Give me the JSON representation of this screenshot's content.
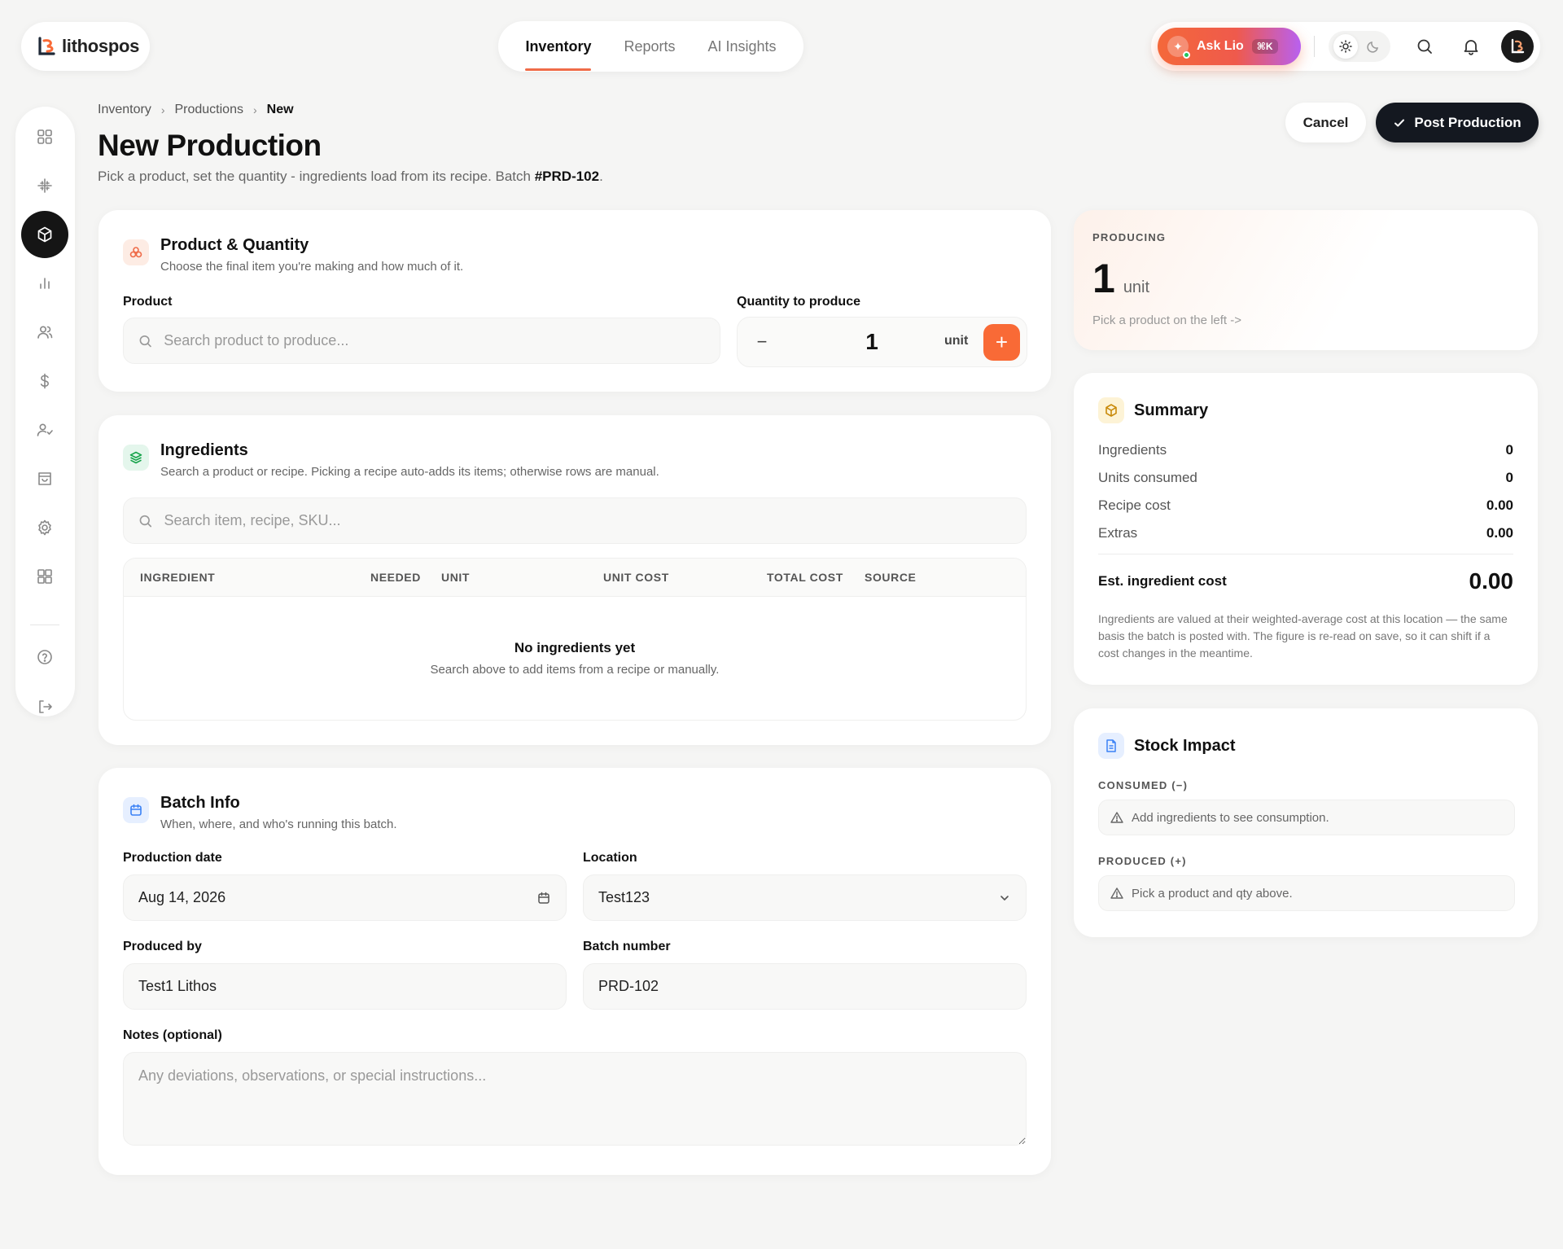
{
  "app": {
    "name": "lithospos",
    "colors": {
      "accent": "#f96a36",
      "dark": "#141820",
      "background": "#f5f5f4"
    }
  },
  "topnav": {
    "tabs": [
      {
        "label": "Inventory",
        "active": true
      },
      {
        "label": "Reports",
        "active": false
      },
      {
        "label": "AI Insights",
        "active": false
      }
    ]
  },
  "topbar": {
    "ask_label": "Ask Lio",
    "ask_shortcut": "⌘K",
    "icons": [
      "sun-icon",
      "moon-icon",
      "search-icon",
      "bell-icon",
      "avatar"
    ]
  },
  "sidebar": {
    "items": [
      {
        "icon": "grid-icon"
      },
      {
        "icon": "snowflake-icon"
      },
      {
        "icon": "box-icon",
        "active": true
      },
      {
        "icon": "bar-chart-icon"
      },
      {
        "icon": "users-icon"
      },
      {
        "icon": "dollar-icon"
      },
      {
        "icon": "user-check-icon"
      },
      {
        "icon": "shopping-bag-icon"
      },
      {
        "icon": "settings-icon"
      },
      {
        "icon": "layout-icon"
      },
      {
        "icon": "help-icon"
      },
      {
        "icon": "logout-icon"
      }
    ]
  },
  "breadcrumb": [
    "Inventory",
    "Productions",
    "New"
  ],
  "header": {
    "title": "New Production",
    "subtitle": "Pick a product, set the quantity - ingredients load from its recipe. Batch ",
    "batch_ref": "#PRD-102",
    "subtitle_end": ".",
    "cancel_label": "Cancel",
    "post_label": "Post Production"
  },
  "product_card": {
    "title": "Product & Quantity",
    "description": "Choose the final item you're making and how much of it.",
    "product_label": "Product",
    "product_placeholder": "Search product to produce...",
    "quantity_label": "Quantity to produce",
    "quantity_value": "1",
    "quantity_unit": "unit",
    "minus": "−",
    "plus": "+"
  },
  "ingredients_card": {
    "title": "Ingredients",
    "description": "Search a product or recipe. Picking a recipe auto-adds its items; otherwise rows are manual.",
    "search_placeholder": "Search item, recipe, SKU...",
    "columns": [
      "INGREDIENT",
      "NEEDED",
      "UNIT",
      "UNIT COST",
      "TOTAL COST",
      "SOURCE"
    ],
    "empty_title": "No ingredients yet",
    "empty_description": "Search above to add items from a recipe or manually."
  },
  "batch_card": {
    "title": "Batch Info",
    "description": "When, where, and who's running this batch.",
    "date_label": "Production date",
    "date_value": "Aug 14, 2026",
    "location_label": "Location",
    "location_value": "Test123",
    "produced_by_label": "Produced by",
    "produced_by_value": "Test1 Lithos",
    "batch_number_label": "Batch number",
    "batch_number_value": "PRD-102",
    "notes_label": "Notes (optional)",
    "notes_placeholder": "Any deviations, observations, or special instructions..."
  },
  "producing_card": {
    "eyebrow": "PRODUCING",
    "quantity": "1",
    "unit": "unit",
    "hint": "Pick a product on the left ->"
  },
  "summary_card": {
    "title": "Summary",
    "rows": [
      {
        "label": "Ingredients",
        "value": "0"
      },
      {
        "label": "Units consumed",
        "value": "0"
      },
      {
        "label": "Recipe cost",
        "value": "0.00"
      },
      {
        "label": "Extras",
        "value": "0.00"
      }
    ],
    "total_label": "Est. ingredient cost",
    "total_value": "0.00",
    "note": "Ingredients are valued at their weighted-average cost at this location — the same basis the batch is posted with. The figure is re-read on save, so it can shift if a cost changes in the meantime."
  },
  "stock_impact_card": {
    "title": "Stock Impact",
    "consumed_label": "CONSUMED (−)",
    "consumed_text": "Add ingredients to see consumption.",
    "produced_label": "PRODUCED (+)",
    "produced_text": "Pick a product and qty above."
  }
}
